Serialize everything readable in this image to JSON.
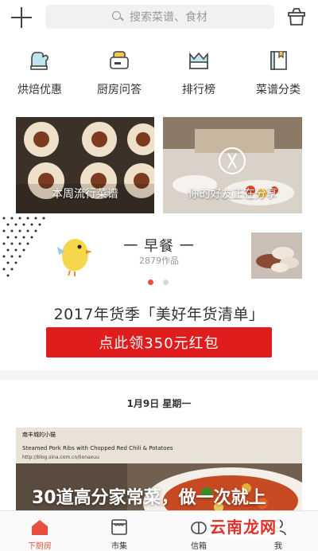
{
  "search": {
    "placeholder": "搜索菜谱、食材"
  },
  "categories": [
    {
      "label": "烘焙优惠",
      "icon": "oven-mitt-icon"
    },
    {
      "label": "厨房问答",
      "icon": "toaster-icon"
    },
    {
      "label": "排行榜",
      "icon": "crown-icon"
    },
    {
      "label": "菜谱分类",
      "icon": "recipe-book-icon"
    }
  ],
  "cards": [
    {
      "label": "本周流行菜谱"
    },
    {
      "label": "你的好友正在分享"
    }
  ],
  "breakfast": {
    "title": "一 早餐 一",
    "count": "2879作品"
  },
  "promo": {
    "title": "2017年货季「美好年货清单」",
    "button": "点此领350元红包"
  },
  "date": "1月9日 星期一",
  "feature": {
    "caption_small": "南丰城的小猫",
    "caption_en": "Steamed Pork Ribs with Chopped Red Chili & Potatoes",
    "caption_url": "http://blog.sina.com.cn/lionaxuu",
    "title": "30道高分家常菜，做一次就上"
  },
  "tabs": [
    {
      "label": "下厨房",
      "icon": "home-icon",
      "active": true
    },
    {
      "label": "市集",
      "icon": "market-icon",
      "active": false
    },
    {
      "label": "信箱",
      "icon": "mailbox-icon",
      "active": false
    },
    {
      "label": "我",
      "icon": "profile-icon",
      "active": false
    }
  ],
  "watermark": "云南龙网",
  "colors": {
    "accent": "#e84f3c",
    "promo_button": "#e11c1c"
  }
}
